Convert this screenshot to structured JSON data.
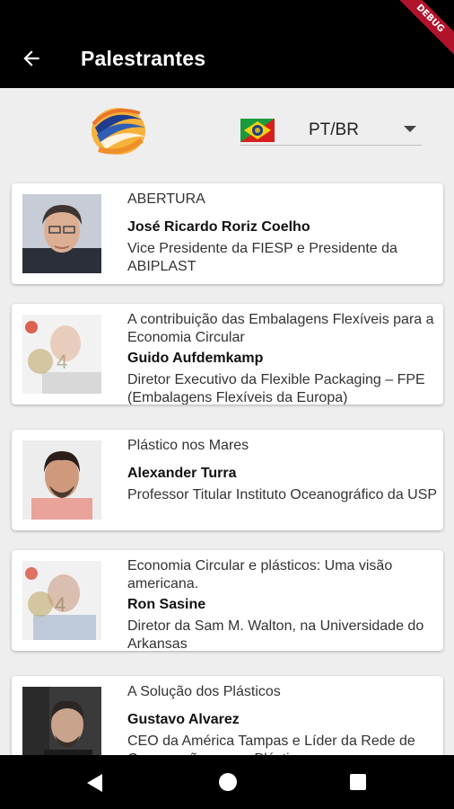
{
  "appbar": {
    "title": "Palestrantes",
    "debug_label": "DEBUG"
  },
  "language": {
    "selected": "PT/BR",
    "flag_icon": "brazil-portugal-flag-icon"
  },
  "speakers": [
    {
      "topic": "ABERTURA",
      "name": "José Ricardo Roriz Coelho",
      "role": "Vice Presidente da FIESP e Presidente da ABIPLAST"
    },
    {
      "topic": "A contribuição das Embalagens Flexíveis para a Economia Circular",
      "name": "Guido Aufdemkamp",
      "role": "Diretor Executivo da Flexible Packaging – FPE (Embalagens Flexíveis da Europa)"
    },
    {
      "topic": "Plástico nos Mares",
      "name": "Alexander Turra",
      "role": "Professor Titular Instituto Oceanográfico da USP"
    },
    {
      "topic": "Economia Circular e plásticos: Uma visão americana.",
      "name": "Ron Sasine",
      "role": "Diretor da Sam M. Walton, na Universidade do Arkansas"
    },
    {
      "topic": "A Solução dos Plásticos",
      "name": "Gustavo Alvarez",
      "role": "CEO da América Tampas e Líder da Rede de Cooperação para o Plástico"
    }
  ],
  "colors": {
    "appbar": "#000000",
    "background": "#eeeeee",
    "card": "#ffffff",
    "logo_blue": "#1f3d8c",
    "logo_orange": "#f39a1e"
  }
}
